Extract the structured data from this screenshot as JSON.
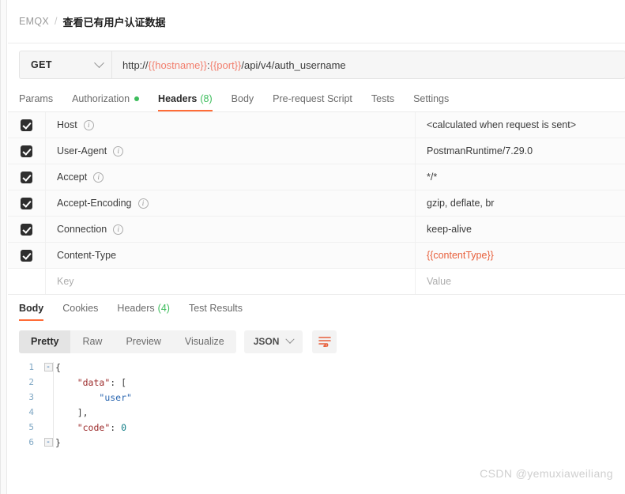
{
  "breadcrumb": {
    "root": "EMQX",
    "separator": "/",
    "current": "查看已有用户认证数据"
  },
  "request": {
    "method": "GET",
    "url_prefix": "http://",
    "url_var_host": "{{hostname}}",
    "url_colon": ":",
    "url_var_port": "{{port}}",
    "url_path": "/api/v4/auth_username",
    "tabs": [
      {
        "label": "Params",
        "active": false,
        "dot": false,
        "count": ""
      },
      {
        "label": "Authorization",
        "active": false,
        "dot": true,
        "count": ""
      },
      {
        "label": "Headers",
        "active": true,
        "dot": false,
        "count": "(8)"
      },
      {
        "label": "Body",
        "active": false,
        "dot": false,
        "count": ""
      },
      {
        "label": "Pre-request Script",
        "active": false,
        "dot": false,
        "count": ""
      },
      {
        "label": "Tests",
        "active": false,
        "dot": false,
        "count": ""
      },
      {
        "label": "Settings",
        "active": false,
        "dot": false,
        "count": ""
      }
    ]
  },
  "headers_table": {
    "key_placeholder": "Key",
    "value_placeholder": "Value",
    "rows": [
      {
        "checked": true,
        "key": "Host",
        "info": true,
        "value": "<calculated when request is sent>",
        "variable": false
      },
      {
        "checked": true,
        "key": "User-Agent",
        "info": true,
        "value": "PostmanRuntime/7.29.0",
        "variable": false
      },
      {
        "checked": true,
        "key": "Accept",
        "info": true,
        "value": "*/*",
        "variable": false
      },
      {
        "checked": true,
        "key": "Accept-Encoding",
        "info": true,
        "value": "gzip, deflate, br",
        "variable": false
      },
      {
        "checked": true,
        "key": "Connection",
        "info": true,
        "value": "keep-alive",
        "variable": false
      },
      {
        "checked": true,
        "key": "Content-Type",
        "info": false,
        "value": "{{contentType}}",
        "variable": true
      }
    ]
  },
  "response": {
    "tabs": [
      {
        "label": "Body",
        "active": true,
        "count": ""
      },
      {
        "label": "Cookies",
        "active": false,
        "count": ""
      },
      {
        "label": "Headers",
        "active": false,
        "count": "(4)"
      },
      {
        "label": "Test Results",
        "active": false,
        "count": ""
      }
    ],
    "format_buttons": [
      {
        "label": "Pretty",
        "active": true
      },
      {
        "label": "Raw",
        "active": false
      },
      {
        "label": "Preview",
        "active": false
      },
      {
        "label": "Visualize",
        "active": false
      }
    ],
    "language": "JSON",
    "body_lines": [
      {
        "n": "1",
        "fold": "-",
        "segments": [
          {
            "t": "{",
            "c": "jpunct"
          }
        ]
      },
      {
        "n": "2",
        "fold": "",
        "segments": [
          {
            "t": "    ",
            "c": "jpunct"
          },
          {
            "t": "\"data\"",
            "c": "jkey"
          },
          {
            "t": ": [",
            "c": "jpunct"
          }
        ]
      },
      {
        "n": "3",
        "fold": "",
        "segments": [
          {
            "t": "        ",
            "c": "jpunct"
          },
          {
            "t": "\"user\"",
            "c": "jstr"
          }
        ]
      },
      {
        "n": "4",
        "fold": "",
        "segments": [
          {
            "t": "    ],",
            "c": "jpunct"
          }
        ]
      },
      {
        "n": "5",
        "fold": "",
        "segments": [
          {
            "t": "    ",
            "c": "jpunct"
          },
          {
            "t": "\"code\"",
            "c": "jkey"
          },
          {
            "t": ": ",
            "c": "jpunct"
          },
          {
            "t": "0",
            "c": "jnum"
          }
        ]
      },
      {
        "n": "6",
        "fold": "-",
        "segments": [
          {
            "t": "}",
            "c": "jpunct"
          }
        ]
      }
    ]
  },
  "watermark": "CSDN @yemuxiaweiliang",
  "colors": {
    "accent_orange": "#ff6c37",
    "variable_red": "#f27f6e",
    "success_green": "#3dbd5c",
    "checkbox_dark": "#2e2e2e"
  }
}
